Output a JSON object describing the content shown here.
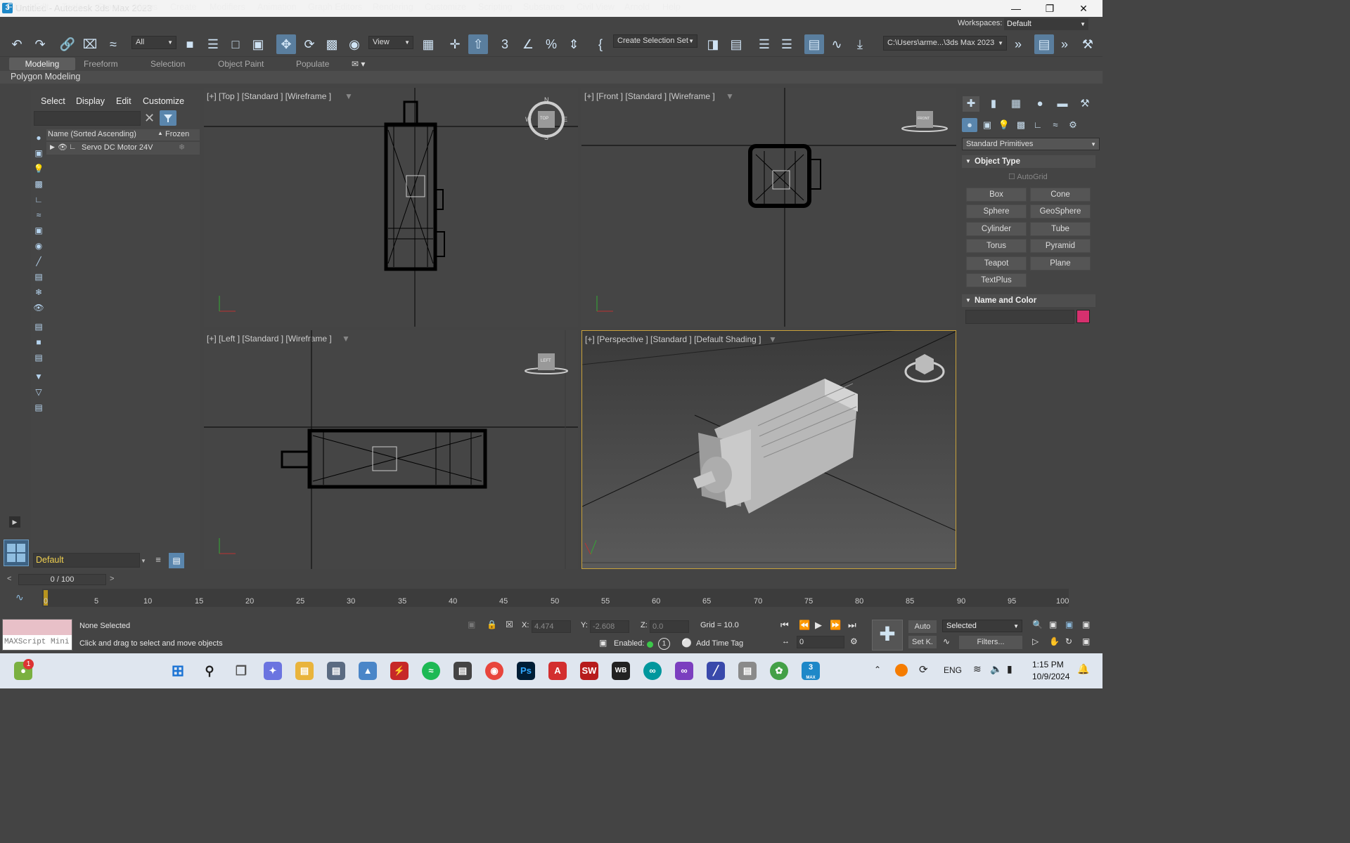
{
  "window": {
    "title": "Untitled - Autodesk 3ds Max 2023",
    "app_icon": "3"
  },
  "menu": [
    "File",
    "Edit",
    "Tools",
    "Group",
    "Views",
    "Create",
    "Modifiers",
    "Animation",
    "Graph Editors",
    "Rendering",
    "Customize",
    "Scripting",
    "Substance",
    "Civil View",
    "Arnold",
    "Help"
  ],
  "workspace": {
    "label": "Workspaces:",
    "value": "Default"
  },
  "toolbar": {
    "filter": "All",
    "ref_coord": "View",
    "selection_set": "Create Selection Set",
    "project_path": "C:\\Users\\arme...\\3ds Max 2023",
    "snap_label": "3"
  },
  "ribbon": {
    "tabs": [
      "Modeling",
      "Freeform",
      "Selection",
      "Object Paint",
      "Populate"
    ],
    "panel": "Polygon Modeling"
  },
  "explorer": {
    "menus": [
      "Select",
      "Display",
      "Edit",
      "Customize"
    ],
    "col_name": "Name (Sorted Ascending)",
    "col_frozen": "Frozen",
    "rows": [
      {
        "name": "Servo DC Motor 24V"
      }
    ],
    "layer": "Default"
  },
  "viewports": {
    "top": "[+] [Top ] [Standard ] [Wireframe ]",
    "front": "[+] [Front ] [Standard ] [Wireframe ]",
    "left": "[+] [Left ] [Standard ] [Wireframe ]",
    "persp": "[+] [Perspective ] [Standard ] [Default Shading ]",
    "cube_top": "TOP",
    "cube_front": "FRONT",
    "cube_left": "LEFT",
    "compass": [
      "N",
      "E",
      "S",
      "W"
    ]
  },
  "command_panel": {
    "dropdown": "Standard Primitives",
    "object_type": "Object Type",
    "autogrid": "AutoGrid",
    "primitives": [
      "Box",
      "Cone",
      "Sphere",
      "GeoSphere",
      "Cylinder",
      "Tube",
      "Torus",
      "Pyramid",
      "Teapot",
      "Plane",
      "TextPlus"
    ],
    "name_color": "Name and Color",
    "color": "#d6306e"
  },
  "timeline": {
    "slider": "0 / 100",
    "ticks": [
      "0",
      "5",
      "10",
      "15",
      "20",
      "25",
      "30",
      "35",
      "40",
      "45",
      "50",
      "55",
      "60",
      "65",
      "70",
      "75",
      "80",
      "85",
      "90",
      "95",
      "100"
    ]
  },
  "status": {
    "maxscript": "MAXScript Mini",
    "selection": "None Selected",
    "prompt": "Click and drag to select and move objects",
    "x_label": "X:",
    "x": "4.474",
    "y_label": "Y:",
    "y": "-2.608",
    "z_label": "Z:",
    "z": "0.0",
    "grid": "Grid = 10.0",
    "enabled": "Enabled:",
    "enabled_count": "1",
    "add_time_tag": "Add Time Tag",
    "auto": "Auto",
    "setk": "Set K.",
    "key_mode": "Selected",
    "filters": "Filters...",
    "frame": "0"
  },
  "taskbar": {
    "time": "1:15 PM",
    "date": "10/9/2024",
    "lang": "ENG",
    "badge": "1",
    "apps": [
      "Ps",
      "A",
      "WB",
      "3",
      "MAX"
    ]
  }
}
